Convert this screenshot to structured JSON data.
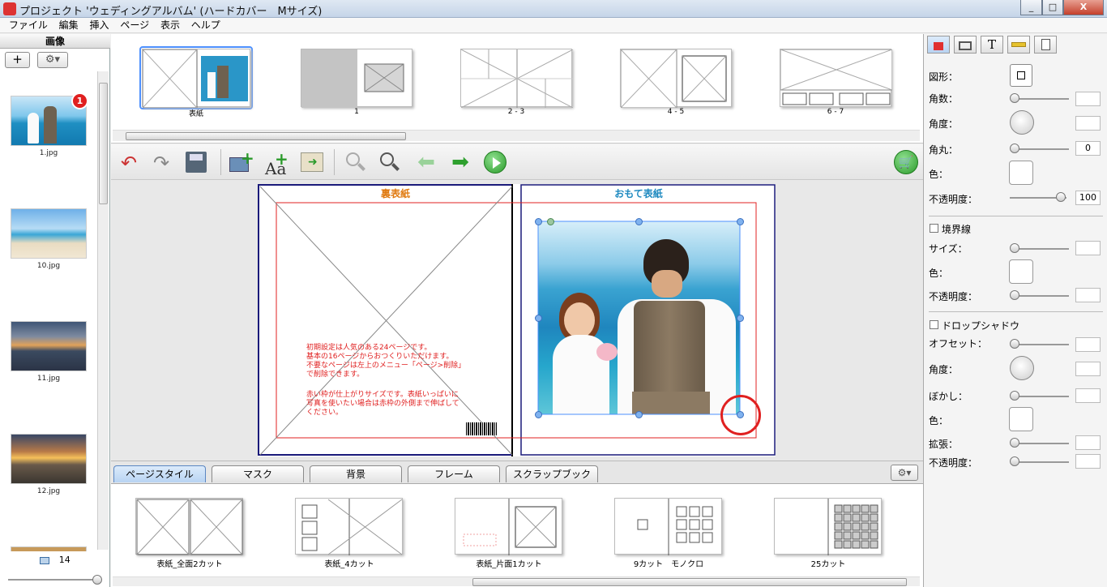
{
  "window": {
    "title": "プロジェクト 'ウェディングアルバム' (ハードカバー　Mサイズ)",
    "min_label": "_",
    "max_label": "□",
    "close_label": "X"
  },
  "menu": [
    "ファイル",
    "編集",
    "挿入",
    "ページ",
    "表示",
    "ヘルプ"
  ],
  "left_panel": {
    "header": "画像",
    "add_label": "+",
    "photos": [
      {
        "label": "1.jpg",
        "badge": "1"
      },
      {
        "label": "10.jpg"
      },
      {
        "label": "11.jpg"
      },
      {
        "label": "12.jpg"
      }
    ],
    "count": "14"
  },
  "spreads": [
    "表紙",
    "1",
    "2 - 3",
    "4 - 5",
    "6 - 7"
  ],
  "canvas": {
    "back_title": "裏表紙",
    "front_title": "おもて表紙",
    "note1": "初期設定は人気のある24ページです。\n基本の16ページからおつくりいただけます。\n不要なページは左上のメニュー「ページ>削除」\nで削除できます。",
    "note2": "赤い枠が仕上がりサイズです。表紙いっぱいに\n写真を使いたい場合は赤枠の外側まで伸ばして\nください。"
  },
  "tabs": [
    "ページスタイル",
    "マスク",
    "背景",
    "フレーム",
    "スクラップブック"
  ],
  "styles": [
    "表紙_全面2カット",
    "表紙_4カット",
    "表紙_片面1カット",
    "9カット　モノクロ",
    "25カット"
  ],
  "right_panel": {
    "shape_label": "図形：",
    "corners_label": "角数：",
    "angle_label": "角度：",
    "rounding_label": "角丸：",
    "rounding_value": "0",
    "color_label": "色：",
    "opacity_label": "不透明度：",
    "opacity_value": "100",
    "border_label": "境界線",
    "size_label": "サイズ：",
    "border_color_label": "色：",
    "border_opacity_label": "不透明度：",
    "shadow_label": "ドロップシャドウ",
    "offset_label": "オフセット：",
    "shadow_angle_label": "角度：",
    "blur_label": "ぼかし：",
    "shadow_color_label": "色：",
    "expand_label": "拡張：",
    "shadow_opacity_label": "不透明度："
  },
  "colors": {
    "accent_red": "#e02020",
    "front_title": "#1f8ac0",
    "back_title": "#e07a10",
    "selection_blue": "#4d90fe"
  }
}
